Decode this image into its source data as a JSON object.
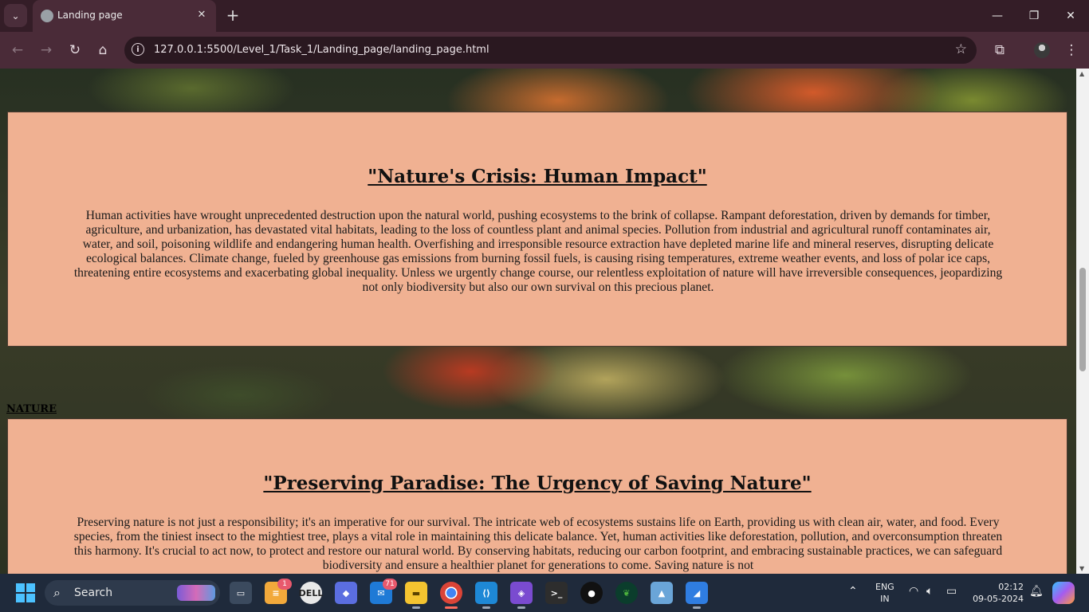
{
  "browser": {
    "tab_title": "Landing page",
    "url": "127.0.0.1:5500/Level_1/Task_1/Landing_page/landing_page.html",
    "new_tab_symbol": "+",
    "tab_close_symbol": "✕",
    "tab_list_symbol": "⌄",
    "window_controls": {
      "minimize": "—",
      "restore": "❐",
      "close": "✕"
    },
    "nav": {
      "back": "←",
      "forward": "→",
      "reload": "↻",
      "home": "⌂",
      "bookmark": "☆",
      "extensions": "⧉",
      "menu": "⋮"
    }
  },
  "page": {
    "section1": {
      "heading": "\"Nature's Crisis: Human Impact\"",
      "body": "Human activities have wrought unprecedented destruction upon the natural world, pushing ecosystems to the brink of collapse. Rampant deforestation, driven by demands for timber, agriculture, and urbanization, has devastated vital habitats, leading to the loss of countless plant and animal species. Pollution from industrial and agricultural runoff contaminates air, water, and soil, poisoning wildlife and endangering human health. Overfishing and irresponsible resource extraction have depleted marine life and mineral reserves, disrupting delicate ecological balances. Climate change, fueled by greenhouse gas emissions from burning fossil fuels, is causing rising temperatures, extreme weather events, and loss of polar ice caps, threatening entire ecosystems and exacerbating global inequality. Unless we urgently change course, our relentless exploitation of nature will have irreversible consequences, jeopardizing not only biodiversity but also our own survival on this precious planet."
    },
    "nature_link": "NATURE",
    "section2": {
      "heading": "\"Preserving Paradise: The Urgency of Saving Nature\"",
      "body": "Preserving nature is not just a responsibility; it's an imperative for our survival. The intricate web of ecosystems sustains life on Earth, providing us with clean air, water, and food. Every species, from the tiniest insect to the mightiest tree, plays a vital role in maintaining this delicate balance. Yet, human activities like deforestation, pollution, and overconsumption threaten this harmony. It's crucial to act now, to protect and restore our natural world. By conserving habitats, reducing our carbon footprint, and embracing sustainable practices, we can safeguard biodiversity and ensure a healthier planet for generations to come. Saving nature is not"
    }
  },
  "taskbar": {
    "search_label": "Search",
    "badges": {
      "notifications_app": "1",
      "mail": "71"
    },
    "apps": [
      "task-view-icon",
      "notes-app-icon",
      "dell-icon",
      "copilot-app-icon",
      "mail-icon",
      "file-explorer-icon",
      "chrome-icon",
      "vscode-icon",
      "git-icon",
      "terminal-icon",
      "github-icon",
      "mongodb-icon",
      "photos-icon",
      "azure-icon"
    ],
    "language_line1": "ENG",
    "language_line2": "IN",
    "time": "02:12",
    "date": "09-05-2024"
  },
  "colors": {
    "card_background": "#f0b192",
    "titlebar": "#341d27",
    "toolbar": "#4a2b38",
    "taskbar": "#1f2a3b"
  }
}
